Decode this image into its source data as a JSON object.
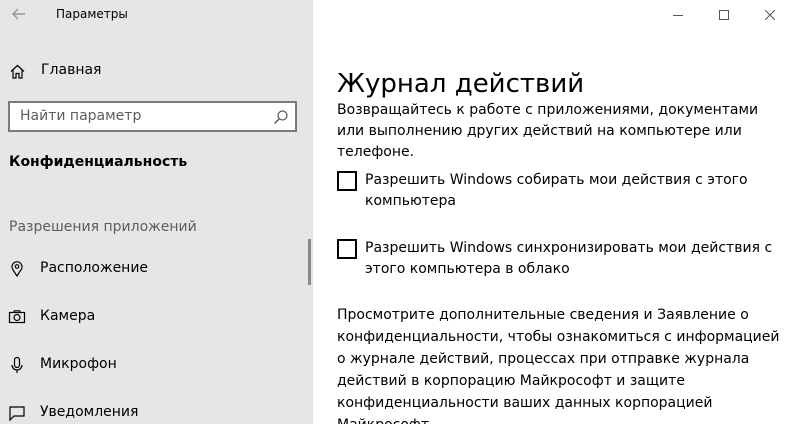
{
  "window": {
    "app_title": "Параметры"
  },
  "sidebar": {
    "home_label": "Главная",
    "search_placeholder": "Найти параметр",
    "section_title": "Конфиденциальность",
    "group_header": "Разрешения приложений",
    "items": [
      {
        "label": "Расположение",
        "icon": "location-pin-icon"
      },
      {
        "label": "Камера",
        "icon": "camera-icon"
      },
      {
        "label": "Микрофон",
        "icon": "microphone-icon"
      },
      {
        "label": "Уведомления",
        "icon": "notification-icon"
      }
    ]
  },
  "main": {
    "title": "Журнал действий",
    "description": "Возвращайтесь к работе с приложениями, документами или выполнению других действий на компьютере или телефоне.",
    "checkboxes": [
      {
        "label": "Разрешить Windows собирать мои действия с этого компьютера",
        "checked": false
      },
      {
        "label": "Разрешить Windows синхронизировать мои действия с этого компьютера в облако",
        "checked": false
      }
    ],
    "info": "Просмотрите дополнительные сведения и Заявление о конфиденциальности, чтобы ознакомиться с информацией о журнале действий, процессах при отправке журнала действий в корпорацию Майкрософт и защите конфиденциальности ваших данных корпорацией Майкрософт."
  },
  "colors": {
    "sidebar_bg": "#e6e6e6",
    "main_bg": "#ffffff",
    "muted_text": "#5d5d5d"
  }
}
